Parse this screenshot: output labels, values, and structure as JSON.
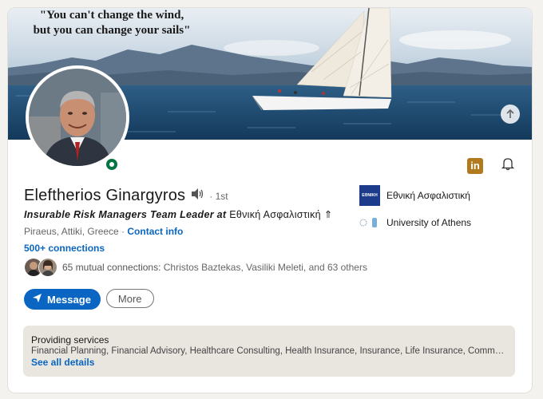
{
  "banner": {
    "quote_line1": "\"You can't change the wind,",
    "quote_line2": "but you can change your sails\""
  },
  "profile": {
    "name": "Eleftherios Ginargyros",
    "degree": "· 1st",
    "headline_role": "Insurable Risk Managers Team Leader at",
    "headline_company": "Εθνική Ασφαλιστική",
    "location": "Piraeus, Attiki, Greece",
    "location_sep": " · ",
    "contact_info": "Contact info",
    "connections": "500+ connections",
    "mutual_count": "65 mutual connections:",
    "mutual_names": " Christos Baztekas, Vasiliki Meleti, and 63 others"
  },
  "actions": {
    "message": "Message",
    "more": "More"
  },
  "experience": [
    {
      "name": "Εθνική Ασφαλιστική",
      "logo_text": "ΕΘΝΙΚΗ"
    },
    {
      "name": "University of Athens"
    }
  ],
  "services": {
    "title": "Providing services",
    "list": "Financial Planning, Financial Advisory, Healthcare Consulting, Health Insurance, Insurance, Life Insurance, Comme...",
    "see_all": "See all details"
  },
  "colors": {
    "accent": "#0a66c2",
    "online": "#057642",
    "linkedin_badge": "#b17a1e"
  },
  "icons": [
    "upload-photo-icon",
    "linkedin-icon",
    "bell-icon",
    "speaker-icon",
    "send-icon",
    "online-status-icon"
  ]
}
